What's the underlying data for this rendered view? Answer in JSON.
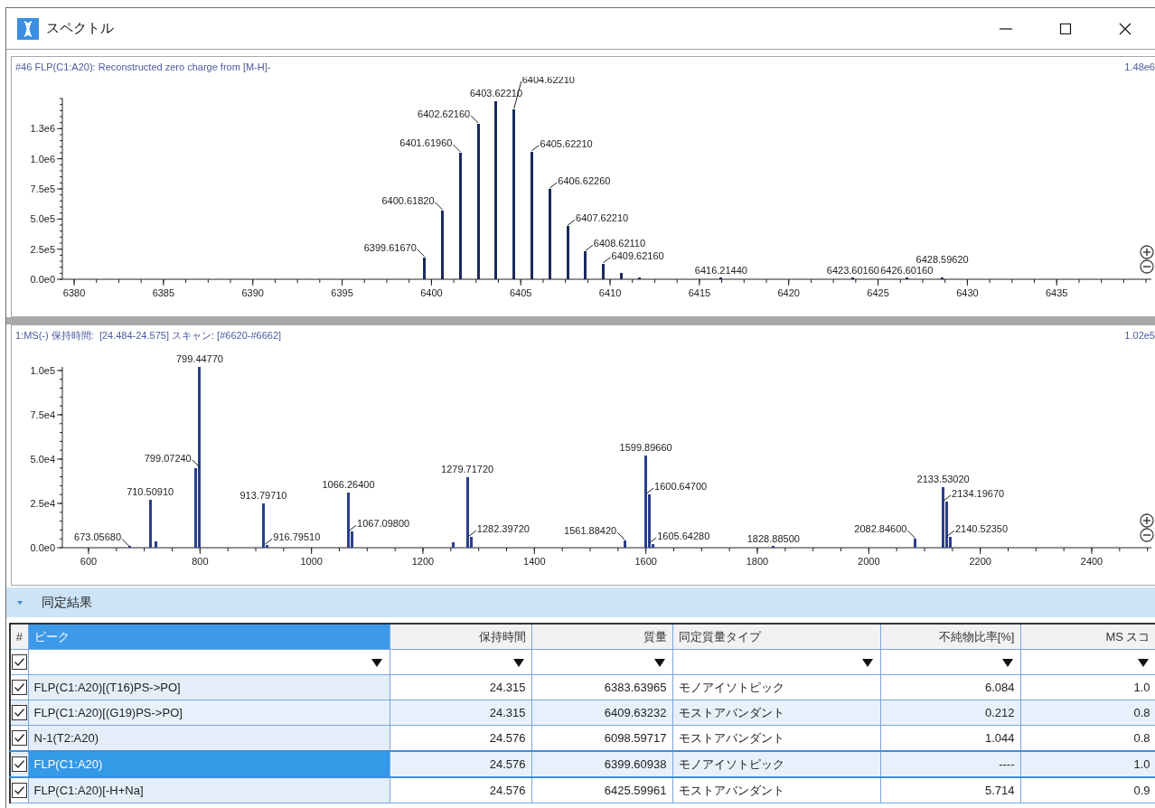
{
  "window": {
    "title": "スペクトル"
  },
  "spectra": [
    {
      "max_label": "1.48e6",
      "chart_data": {
        "type": "bar",
        "title": "#46 FLP(C1:A20): Reconstructed zero charge from [M-H]-",
        "x": [
          6399.6167,
          6400.6182,
          6401.6196,
          6402.6216,
          6403.6221,
          6404.6221,
          6405.6221,
          6406.6226,
          6407.6221,
          6408.6211,
          6409.6216,
          6410.62,
          6411.62,
          6416.2144,
          6423.6016,
          6426.6016,
          6428.5962
        ],
        "values": [
          180000,
          570000,
          1050000,
          1290000,
          1480000,
          1410000,
          1060000,
          750000,
          440000,
          230000,
          130000,
          50000,
          15000,
          10000,
          5000,
          5000,
          5000
        ],
        "annotations": [
          {
            "x": 6399.6167,
            "y": 180000,
            "text": "6399.61670"
          },
          {
            "x": 6400.6182,
            "y": 570000,
            "text": "6400.61820"
          },
          {
            "x": 6401.6196,
            "y": 1050000,
            "text": "6401.61960"
          },
          {
            "x": 6402.6216,
            "y": 1290000,
            "text": "6402.62160"
          },
          {
            "x": 6403.6221,
            "y": 1480000,
            "text": "6403.62210"
          },
          {
            "x": 6404.6221,
            "y": 1410000,
            "text": "6404.62210"
          },
          {
            "x": 6405.6221,
            "y": 1060000,
            "text": "6405.62210"
          },
          {
            "x": 6406.6226,
            "y": 750000,
            "text": "6406.62260"
          },
          {
            "x": 6407.6221,
            "y": 440000,
            "text": "6407.62210"
          },
          {
            "x": 6408.6211,
            "y": 230000,
            "text": "6408.62110"
          },
          {
            "x": 6409.6216,
            "y": 130000,
            "text": "6409.62160"
          },
          {
            "x": 6416.2144,
            "y": 10000,
            "text": "6416.21440"
          },
          {
            "x": 6423.6016,
            "y": 5000,
            "text": "6423.60160"
          },
          {
            "x": 6426.6016,
            "y": 5000,
            "text": "6426.60160"
          },
          {
            "x": 6428.5962,
            "y": 5000,
            "text": "6428.59620"
          }
        ],
        "xlim": [
          6379.34,
          6440.3
        ],
        "ylim": [
          0,
          1500000
        ],
        "xticks": [
          6380,
          6385,
          6390,
          6395,
          6400,
          6405,
          6410,
          6415,
          6420,
          6425,
          6430,
          6435
        ],
        "yticks": [
          {
            "value": 0,
            "label": "0.0e0"
          },
          {
            "value": 250000,
            "label": "2.5e5"
          },
          {
            "value": 500000,
            "label": "5.0e5"
          },
          {
            "value": 750000,
            "label": "7.5e5"
          },
          {
            "value": 1000000,
            "label": "1.0e6"
          },
          {
            "value": 1250000,
            "label": "1.3e6"
          }
        ]
      }
    },
    {
      "max_label": "1.02e5",
      "chart_data": {
        "type": "bar",
        "title": "1:MS(-) 保持時間:  [24.484-24.575] スキャン: [#6620-#6662]",
        "x": [
          673.0568,
          710.5091,
          720.5,
          799.0724,
          799.4477,
          913.7971,
          916.7951,
          1066.264,
          1067.098,
          1255.0,
          1279.7172,
          1282.3972,
          1561.8842,
          1599.8966,
          1600.647,
          1605.6428,
          1828.885,
          2082.846,
          2133.5302,
          2134.1967,
          2140.5235
        ],
        "values": [
          300,
          27000,
          3500,
          45000,
          102000,
          25000,
          1500,
          31000,
          9000,
          3000,
          40000,
          6000,
          4000,
          52000,
          30000,
          2000,
          300,
          5000,
          34000,
          26000,
          6000
        ],
        "annotations": [
          {
            "x": 673.0568,
            "y": 300,
            "text": "673.05680"
          },
          {
            "x": 710.5091,
            "y": 27000,
            "text": "710.50910"
          },
          {
            "x": 799.0724,
            "y": 45000,
            "text": "799.07240"
          },
          {
            "x": 799.4477,
            "y": 102000,
            "text": "799.44770"
          },
          {
            "x": 913.7971,
            "y": 25000,
            "text": "913.79710"
          },
          {
            "x": 916.7951,
            "y": 1500,
            "text": "916.79510"
          },
          {
            "x": 1066.264,
            "y": 31000,
            "text": "1066.26400"
          },
          {
            "x": 1067.098,
            "y": 9000,
            "text": "1067.09800"
          },
          {
            "x": 1279.7172,
            "y": 40000,
            "text": "1279.71720"
          },
          {
            "x": 1282.3972,
            "y": 6000,
            "text": "1282.39720"
          },
          {
            "x": 1561.8842,
            "y": 4000,
            "text": "1561.88420"
          },
          {
            "x": 1599.8966,
            "y": 52000,
            "text": "1599.89660"
          },
          {
            "x": 1600.647,
            "y": 30000,
            "text": "1600.64700"
          },
          {
            "x": 1605.6428,
            "y": 2000,
            "text": "1605.64280"
          },
          {
            "x": 1828.885,
            "y": 300,
            "text": "1828.88500"
          },
          {
            "x": 2082.846,
            "y": 5000,
            "text": "2082.84600"
          },
          {
            "x": 2133.5302,
            "y": 34000,
            "text": "2133.53020"
          },
          {
            "x": 2134.1967,
            "y": 26000,
            "text": "2134.19670"
          },
          {
            "x": 2140.5235,
            "y": 6000,
            "text": "2140.52350"
          }
        ],
        "xlim": [
          553,
          2507
        ],
        "ylim": [
          0,
          102000
        ],
        "xticks": [
          600,
          800,
          1000,
          1200,
          1400,
          1600,
          1800,
          2000,
          2200,
          2400
        ],
        "yticks": [
          {
            "value": 0,
            "label": "0.0e0"
          },
          {
            "value": 25000,
            "label": "2.5e4"
          },
          {
            "value": 50000,
            "label": "5.0e4"
          },
          {
            "value": 75000,
            "label": "7.5e4"
          },
          {
            "value": 100000,
            "label": "1.0e5"
          }
        ]
      }
    }
  ],
  "results": {
    "title": "同定結果",
    "expanded": true,
    "check_column": {
      "label": "#",
      "kind": "check",
      "selected": false
    },
    "filter_checked": true,
    "columns": [
      {
        "label": "ピーク",
        "kind": "text",
        "selected": true
      },
      {
        "label": "保持時間",
        "kind": "number",
        "selected": false
      },
      {
        "label": "質量",
        "kind": "number",
        "selected": false
      },
      {
        "label": "同定質量タイプ",
        "kind": "text",
        "selected": false
      },
      {
        "label": "不純物比率[%]",
        "kind": "number",
        "selected": false
      },
      {
        "label": "MS スコ",
        "kind": "number",
        "selected": false
      }
    ],
    "rows": [
      {
        "checked": true,
        "selected": false,
        "cells": [
          "FLP(C1:A20)[(T16)PS->PO]",
          "24.315",
          "6383.63965",
          "モノアイソトピック",
          "6.084",
          "1.0"
        ]
      },
      {
        "checked": true,
        "selected": false,
        "cells": [
          "FLP(C1:A20)[(G19)PS->PO]",
          "24.315",
          "6409.63232",
          "モストアバンダント",
          "0.212",
          "0.8"
        ]
      },
      {
        "checked": true,
        "selected": false,
        "cells": [
          "N-1(T2:A20)",
          "24.576",
          "6098.59717",
          "モストアバンダント",
          "1.044",
          "0.8"
        ]
      },
      {
        "checked": true,
        "selected": true,
        "cells": [
          "FLP(C1:A20)",
          "24.576",
          "6399.60938",
          "モノアイソトピック",
          "----",
          "1.0"
        ]
      },
      {
        "checked": true,
        "selected": false,
        "cells": [
          "FLP(C1:A20)[-H+Na]",
          "24.576",
          "6425.59961",
          "モストアバンダント",
          "5.714",
          "0.9"
        ]
      }
    ]
  }
}
